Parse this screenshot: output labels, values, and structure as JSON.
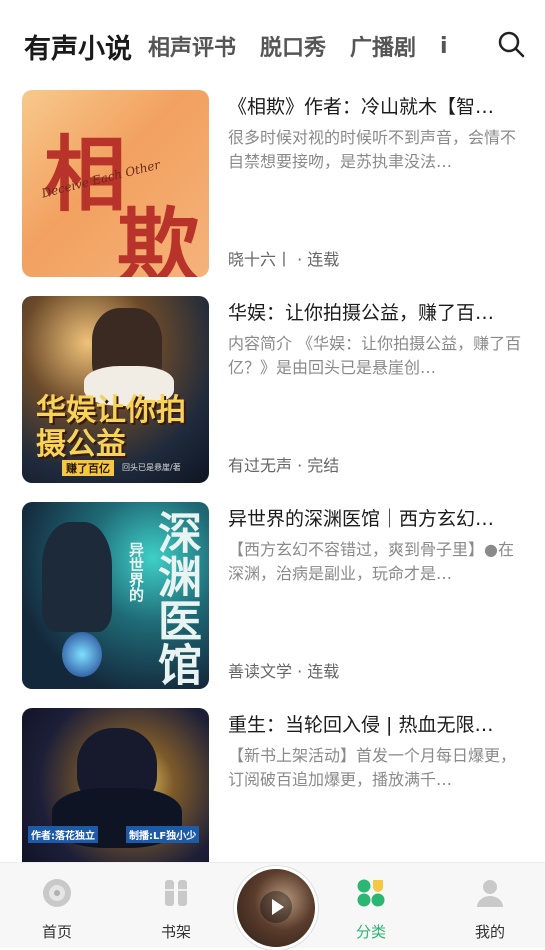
{
  "tabs": [
    "有声小说",
    "相声评书",
    "脱口秀",
    "广播剧",
    "i"
  ],
  "books": [
    {
      "title": "《相欺》作者：冷山就木【智…",
      "desc": "很多时候对视的时候听不到声音，会情不自禁想要接吻，是苏执聿没法…",
      "meta": "晓十六丨 · 连载",
      "cover_text": "相",
      "cover_text2": "欺",
      "cover_sub": "Deceive Each Other"
    },
    {
      "title": "华娱：让你拍摄公益，赚了百…",
      "desc": "内容简介 《华娱：让你拍摄公益，赚了百亿？》是由回头已是悬崖创…",
      "meta": "有过无声 · 完结",
      "cover_text": "华娱让你拍摄公益",
      "cover_sub": "赚了百亿",
      "cover_author": "回头已是悬崖/著"
    },
    {
      "title": "异世界的深渊医馆｜西方玄幻…",
      "desc": "【西方玄幻不容错过，爽到骨子里】●在深渊，治病是副业，玩命才是…",
      "meta": "善读文学 · 连载",
      "cover_text": "深渊医馆",
      "cover_sub": "异世界的"
    },
    {
      "title": "重生：当轮回入侵 | 热血无限…",
      "desc": "【新书上架活动】首发一个月每日爆更，订阅破百追加爆更，播放满千…",
      "meta": "",
      "cover_author": "作者:落花独立",
      "cover_maker": "制播:LF独小少"
    }
  ],
  "nav": [
    {
      "label": "首页",
      "icon": "home-disc-icon"
    },
    {
      "label": "书架",
      "icon": "bookshelf-icon"
    },
    {
      "label": "分类",
      "icon": "category-icon",
      "active": true
    },
    {
      "label": "我的",
      "icon": "profile-icon"
    }
  ],
  "colors": {
    "accent": "#2bb673",
    "tab_active": "#1a1a1a",
    "tab_inactive": "#555555"
  }
}
